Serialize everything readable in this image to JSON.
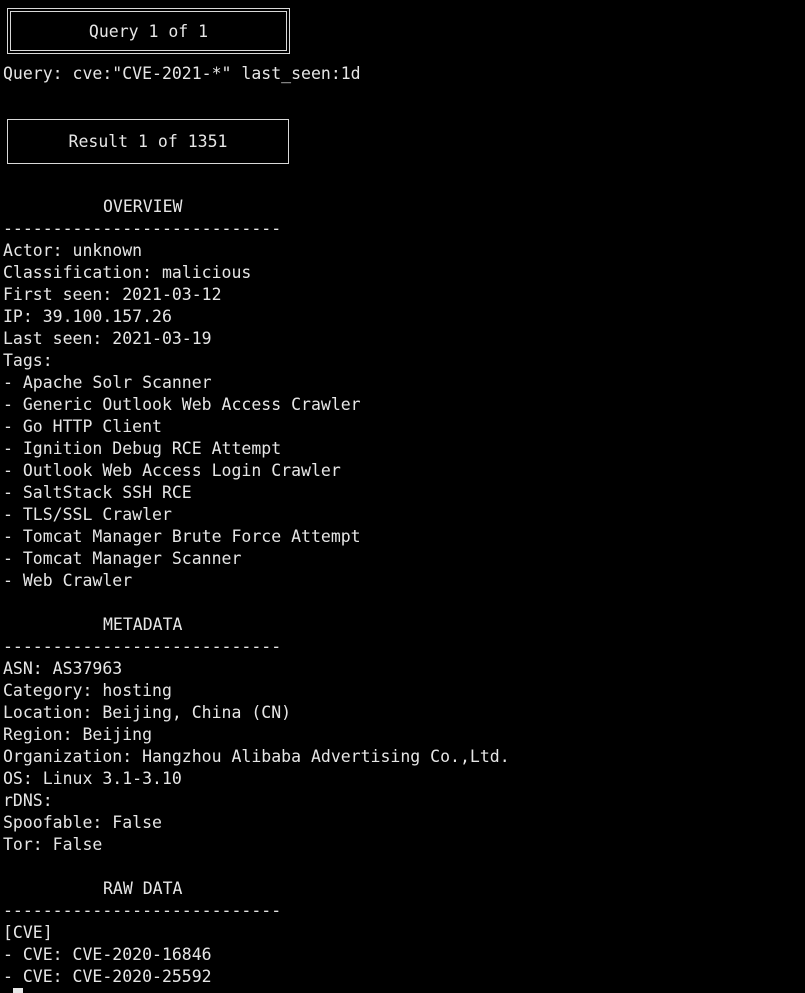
{
  "query_box": "Query 1 of 1",
  "query_line": "Query: cve:\"CVE-2021-*\" last_seen:1d",
  "result_box": "Result 1 of 1351",
  "overview": {
    "heading": "OVERVIEW",
    "separator": "----------------------------",
    "actor": "Actor: unknown",
    "classification": "Classification: malicious",
    "first_seen": "First seen: 2021-03-12",
    "ip": "IP: 39.100.157.26",
    "last_seen": "Last seen: 2021-03-19",
    "tags_label": "Tags:",
    "tags": [
      "- Apache Solr Scanner",
      "- Generic Outlook Web Access Crawler",
      "- Go HTTP Client",
      "- Ignition Debug RCE Attempt",
      "- Outlook Web Access Login Crawler",
      "- SaltStack SSH RCE",
      "- TLS/SSL Crawler",
      "- Tomcat Manager Brute Force Attempt",
      "- Tomcat Manager Scanner",
      "- Web Crawler"
    ]
  },
  "metadata": {
    "heading": "METADATA",
    "separator": "----------------------------",
    "asn": "ASN: AS37963",
    "category": "Category: hosting",
    "location": "Location: Beijing, China (CN)",
    "region": "Region: Beijing",
    "organization": "Organization: Hangzhou Alibaba Advertising Co.,Ltd.",
    "os": "OS: Linux 3.1-3.10",
    "rdns": "rDNS:",
    "spoofable": "Spoofable: False",
    "tor": "Tor: False"
  },
  "raw_data": {
    "heading": "RAW DATA",
    "separator": "----------------------------",
    "cve_label": "[CVE]",
    "cves": [
      "- CVE: CVE-2020-16846",
      "- CVE: CVE-2020-25592"
    ]
  }
}
